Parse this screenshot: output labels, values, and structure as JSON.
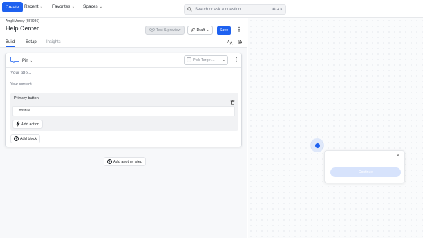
{
  "nav": {
    "create": "Create",
    "recent": "Recent",
    "favorites": "Favorites",
    "spaces": "Spaces",
    "search_placeholder": "Search or ask a question",
    "search_shortcut": "⌘ + K"
  },
  "header": {
    "org": "AmpliMoney (657986)",
    "title": "Help Center",
    "test_preview": "Test & preview",
    "draft": "Draft",
    "save": "Save"
  },
  "tabs": [
    "Build",
    "Setup",
    "Insights"
  ],
  "step": {
    "type": "Pin",
    "pick_target": "Pick Target...",
    "title_placeholder": "Your title...",
    "content_placeholder": "Your content",
    "primary_button_label": "Primary button",
    "button_text": "Continue",
    "add_action": "Add action",
    "add_block": "Add block"
  },
  "add_step": "Add another step",
  "preview": {
    "button": "Continue",
    "close": "×"
  },
  "colors": {
    "accent": "#1e61f0"
  }
}
